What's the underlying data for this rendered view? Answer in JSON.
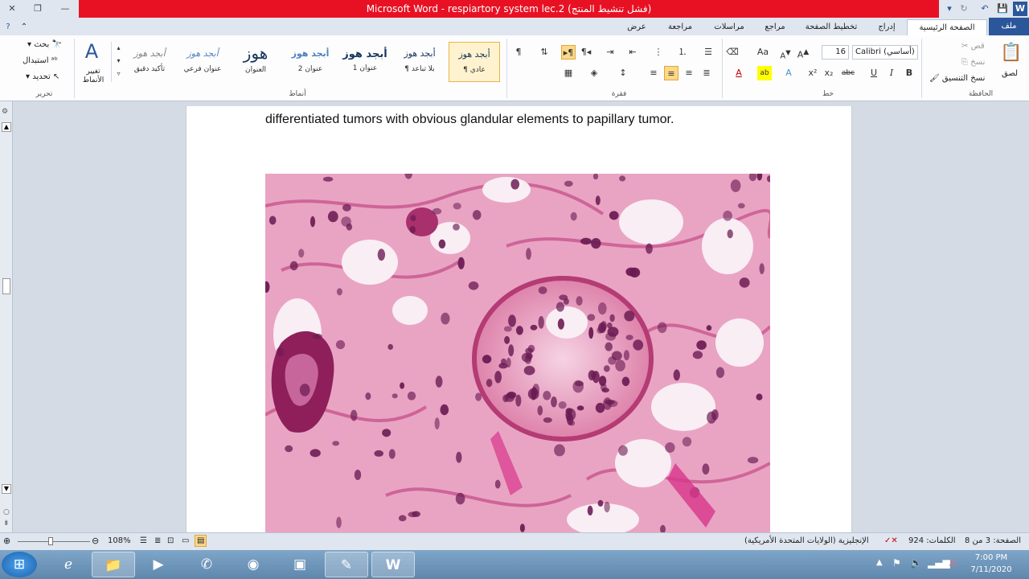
{
  "window": {
    "title": "Microsoft Word  -  respiartory system lec.2 (فشل تنشيط المنتج)",
    "title_display": "Microsoft Word  -  respiartory system lec.2 (فشل تنشيط المنتج)"
  },
  "tabs": [
    {
      "label": "ملف"
    },
    {
      "label": "الصفحة الرئيسية"
    },
    {
      "label": "إدراج"
    },
    {
      "label": "تخطيط الصفحة"
    },
    {
      "label": "مراجع"
    },
    {
      "label": "مراسلات"
    },
    {
      "label": "مراجعة"
    },
    {
      "label": "عرض"
    }
  ],
  "ribbon": {
    "clipboard": {
      "label": "الحافظة",
      "paste": "لصق",
      "cut": "قص",
      "copy": "نسخ",
      "format_painter": "نسخ التنسيق"
    },
    "font": {
      "label": "خط",
      "name": "Calibri (أساسي)",
      "size": "16"
    },
    "paragraph": {
      "label": "فقرة"
    },
    "styles": {
      "label": "أنماط",
      "items": [
        {
          "sample": "أبجد هوز",
          "name": "¶ عادي"
        },
        {
          "sample": "أبجد هوز",
          "name": "¶ بلا تباعد"
        },
        {
          "sample": "أبجد هوز",
          "name": "عنوان 1"
        },
        {
          "sample": "أبجد هوز",
          "name": "عنوان 2"
        },
        {
          "sample": "هوز",
          "name": "العنوان"
        },
        {
          "sample": "أبجد هوز",
          "name": "عنوان فرعي"
        },
        {
          "sample": "أبجد هوز",
          "name": "تأكيد دقيق"
        }
      ],
      "change_styles": "تغيير الأنماط"
    },
    "editing": {
      "label": "تحرير",
      "find": "بحث",
      "replace": "استبدال",
      "select": "تحديد"
    }
  },
  "document": {
    "text_line": "differentiated tumors with obvious glandular elements to papillary tumor."
  },
  "status": {
    "page": "الصفحة: 3 من 8",
    "words": "الكلمات: 924",
    "language": "الإنجليزية (الولايات المتحدة الأمريكية)",
    "zoom": "108%"
  },
  "taskbar": {
    "time": "7:00 PM",
    "date": "7/11/2020"
  }
}
